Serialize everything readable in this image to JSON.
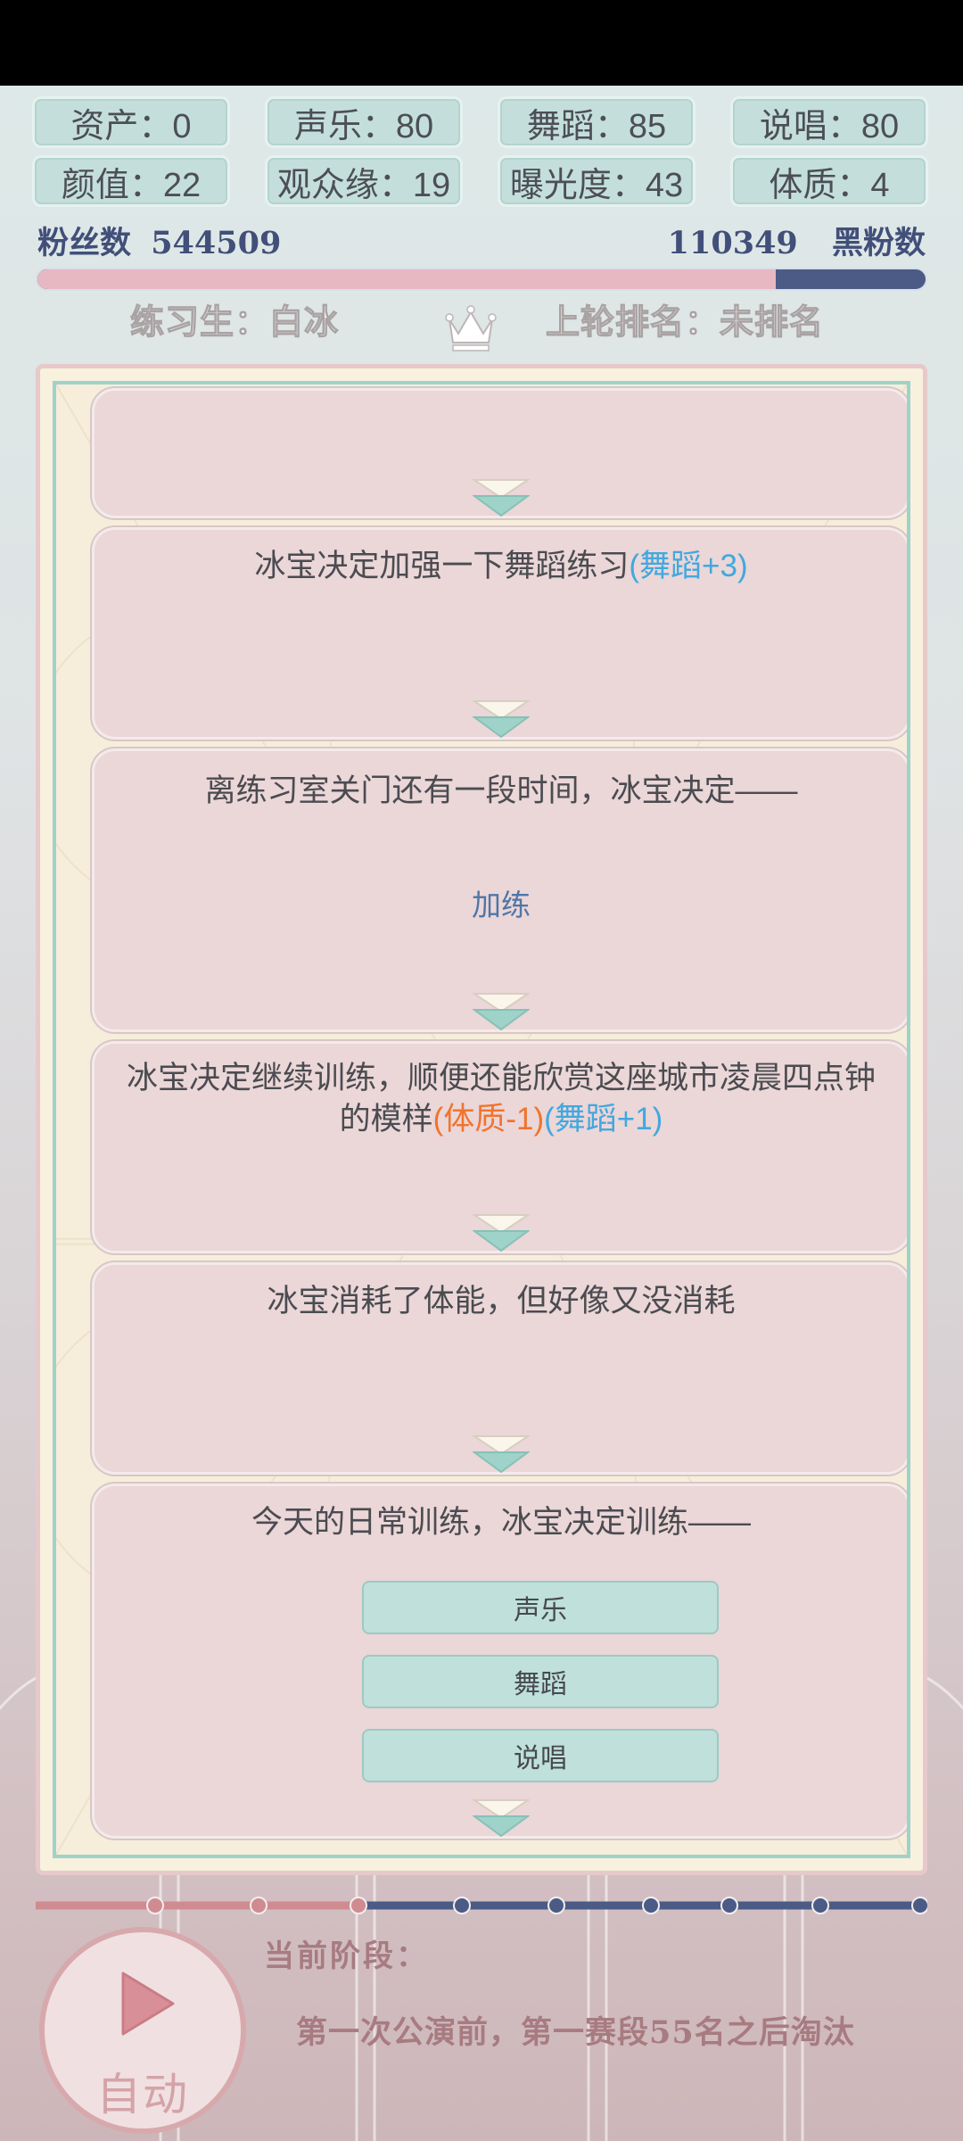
{
  "stats": {
    "row1": [
      {
        "label": "资产：0"
      },
      {
        "label": "声乐：80"
      },
      {
        "label": "舞蹈：85"
      },
      {
        "label": "说唱：80"
      }
    ],
    "row2": [
      {
        "label": "颜值：22"
      },
      {
        "label": "观众缘：19"
      },
      {
        "label": "曝光度：43"
      },
      {
        "label": "体质：4"
      }
    ]
  },
  "fans": {
    "fans_label": "粉丝数",
    "fans_value": "544509",
    "anti_value": "110349",
    "anti_label": "黑粉数",
    "fans_share": 0.831
  },
  "trainee": {
    "name_label": "练习生：白冰",
    "rank_label": "上轮排名：未排名"
  },
  "log": [
    {
      "segments": []
    },
    {
      "segments": [
        {
          "text": "冰宝决定加强一下舞蹈练习",
          "style": ""
        },
        {
          "text": "(舞蹈+3)",
          "style": "blue"
        }
      ]
    },
    {
      "segments": [
        {
          "text": "离练习室关门还有一段时间，冰宝决定——",
          "style": ""
        }
      ],
      "choice": "加练"
    },
    {
      "segments": [
        {
          "text": "冰宝决定继续训练，顺便还能欣赏这座城市凌晨四点钟的模样",
          "style": ""
        },
        {
          "text": "(体质-1)",
          "style": "orange"
        },
        {
          "text": "(舞蹈+1)",
          "style": "blue"
        }
      ]
    },
    {
      "segments": [
        {
          "text": "冰宝消耗了体能，但好像又没消耗",
          "style": ""
        }
      ]
    },
    {
      "segments": [
        {
          "text": "今天的日常训练，冰宝决定训练——",
          "style": ""
        }
      ],
      "options": [
        "声乐",
        "舞蹈",
        "说唱"
      ]
    }
  ],
  "progress": {
    "total_nodes": 10,
    "completed_nodes": 3
  },
  "auto_button": {
    "label": "自动",
    "icon": "play-icon"
  },
  "phase": {
    "title": "当前阶段：",
    "text": "第一次公演前，第一赛段55名之后淘汰"
  },
  "colors": {
    "accent_pink": "#d08b91",
    "accent_navy": "#4b5b86",
    "tile_teal": "#c4dfdb",
    "blue_effect": "#42a8de",
    "orange_effect": "#f0742e"
  }
}
